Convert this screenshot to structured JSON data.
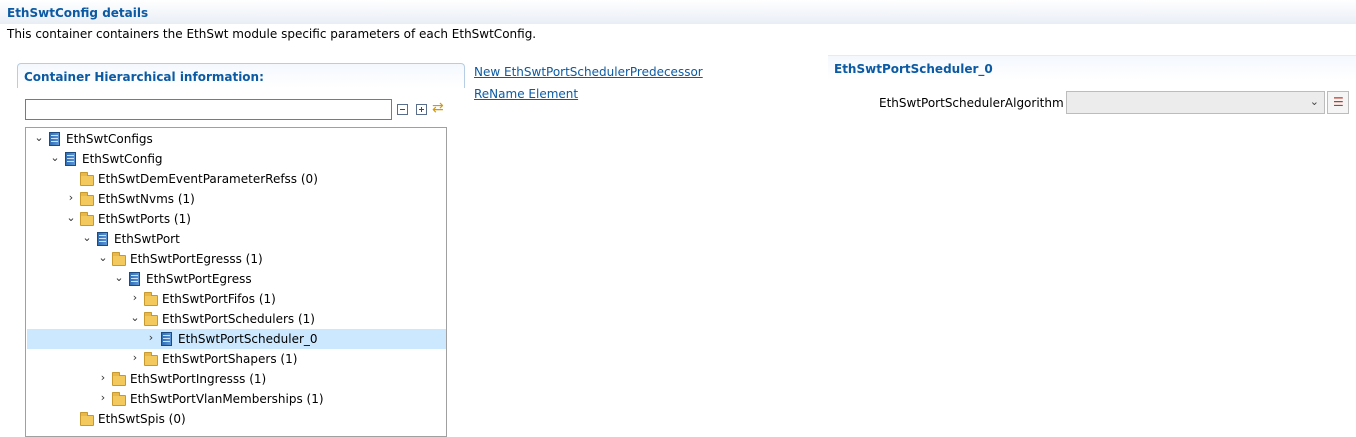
{
  "header": {
    "title": "EthSwtConfig details",
    "description": "This container containers the EthSwt module specific parameters of each EthSwtConfig."
  },
  "hierarchy": {
    "title": "Container Hierarchical information:",
    "filter_value": "",
    "tree": [
      {
        "label": "EthSwtConfigs",
        "type": "container",
        "expander": "expanded"
      },
      {
        "label": "EthSwtConfig",
        "type": "container",
        "expander": "expanded"
      },
      {
        "label": "EthSwtDemEventParameterRefss (0)",
        "type": "folder",
        "expander": "none"
      },
      {
        "label": "EthSwtNvms (1)",
        "type": "folder",
        "expander": "collapsed"
      },
      {
        "label": "EthSwtPorts (1)",
        "type": "folder",
        "expander": "expanded"
      },
      {
        "label": "EthSwtPort",
        "type": "container",
        "expander": "expanded"
      },
      {
        "label": "EthSwtPortEgresss (1)",
        "type": "folder",
        "expander": "expanded"
      },
      {
        "label": "EthSwtPortEgress",
        "type": "container",
        "expander": "expanded"
      },
      {
        "label": "EthSwtPortFifos (1)",
        "type": "folder",
        "expander": "collapsed"
      },
      {
        "label": "EthSwtPortSchedulers (1)",
        "type": "folder",
        "expander": "expanded"
      },
      {
        "label": "EthSwtPortScheduler_0",
        "type": "container",
        "expander": "collapsed",
        "selected": true
      },
      {
        "label": "EthSwtPortShapers (1)",
        "type": "folder",
        "expander": "collapsed"
      },
      {
        "label": "EthSwtPortIngresss (1)",
        "type": "folder",
        "expander": "collapsed"
      },
      {
        "label": "EthSwtPortVlanMemberships (1)",
        "type": "folder",
        "expander": "collapsed"
      },
      {
        "label": "EthSwtSpis (0)",
        "type": "folder",
        "expander": "none"
      }
    ]
  },
  "actions": {
    "new_link": "New EthSwtPortSchedulerPredecessor",
    "rename_link": "ReName Element"
  },
  "details": {
    "title": "EthSwtPortScheduler_0",
    "field_label": "EthSwtPortSchedulerAlgorithm :",
    "field_value": ""
  },
  "colors": {
    "accent": "#0b5aa3",
    "selection": "#cce8ff"
  }
}
